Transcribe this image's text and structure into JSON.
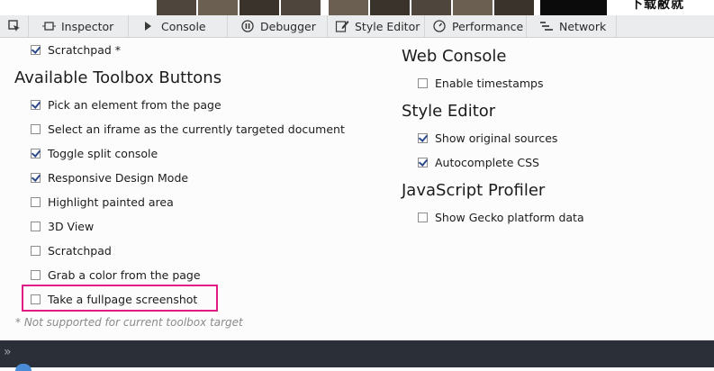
{
  "toolbar": {
    "tabs": [
      {
        "label": "Inspector",
        "icon": "inspector-icon"
      },
      {
        "label": "Console",
        "icon": "console-chevron-icon"
      },
      {
        "label": "Debugger",
        "icon": "debugger-pause-icon"
      },
      {
        "label": "Style Editor",
        "icon": "style-editor-pencil-icon"
      },
      {
        "label": "Performance",
        "icon": "performance-clock-icon"
      },
      {
        "label": "Network",
        "icon": "network-icon"
      }
    ],
    "pick_icon": "pick-element-icon"
  },
  "top_partial_text": "下载敝就",
  "left": {
    "scratchpad_top": {
      "label": "Scratchpad *",
      "checked": true
    },
    "heading": "Available Toolbox Buttons",
    "items": [
      {
        "label": "Pick an element from the page",
        "checked": true
      },
      {
        "label": "Select an iframe as the currently targeted document",
        "checked": false
      },
      {
        "label": "Toggle split console",
        "checked": true
      },
      {
        "label": "Responsive Design Mode",
        "checked": true
      },
      {
        "label": "Highlight painted area",
        "checked": false
      },
      {
        "label": "3D View",
        "checked": false
      },
      {
        "label": "Scratchpad",
        "checked": false
      },
      {
        "label": "Grab a color from the page",
        "checked": false
      },
      {
        "label": "Take a fullpage screenshot",
        "checked": false
      }
    ],
    "note": "* Not supported for current toolbox target"
  },
  "right": {
    "web_console": {
      "heading": "Web Console",
      "items": [
        {
          "label": "Enable timestamps",
          "checked": false
        }
      ]
    },
    "style_editor": {
      "heading": "Style Editor",
      "items": [
        {
          "label": "Show original sources",
          "checked": true
        },
        {
          "label": "Autocomplete CSS",
          "checked": true
        }
      ]
    },
    "js_profiler": {
      "heading": "JavaScript Profiler",
      "items": [
        {
          "label": "Show Gecko platform data",
          "checked": false
        }
      ]
    }
  },
  "colors": {
    "highlight": "#e01b84",
    "footer": "#2b3038",
    "toolbar": "#ebeced"
  }
}
